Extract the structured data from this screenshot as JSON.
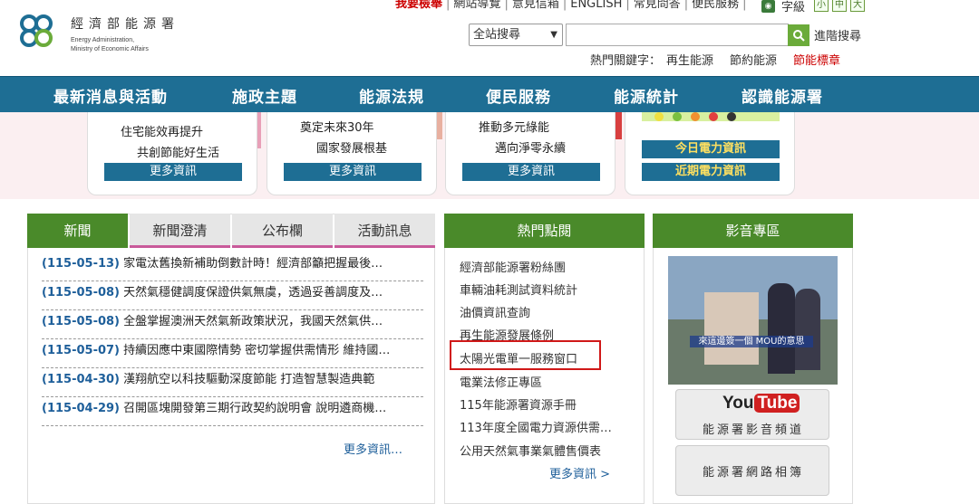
{
  "header": {
    "logo_title": "經濟部能源署",
    "logo_sub_1": "Energy Administration,",
    "logo_sub_2": "Ministry of Economic Affairs",
    "top_links": [
      "要檢舉",
      "網站導覽",
      "意見信箱",
      "ENGLISH",
      "常見問答",
      "便民服務"
    ],
    "top_link_first_prefix": "我",
    "font_label": "字級",
    "font_sizes": [
      "小",
      "中",
      "大"
    ],
    "search_scope": "全站搜尋",
    "search_value": "",
    "advanced_search": "進階搜尋",
    "hot_keywords_label": "熱門關鍵字：",
    "hot_keywords": [
      "再生能源",
      "節約能源",
      "節能標章"
    ]
  },
  "nav": [
    "最新消息與活動",
    "施政主題",
    "能源法規",
    "便民服務",
    "能源統計",
    "認識能源署"
  ],
  "cards": [
    {
      "line1": "住宅能效再提升",
      "line2": "共創節能好生活",
      "more": "更多資訊"
    },
    {
      "line1": "奠定未來30年",
      "line2": "國家發展根基",
      "more": "更多資訊"
    },
    {
      "line1": "推動多元綠能",
      "line2": "邁向淨零永續",
      "more": "更多資訊"
    },
    {
      "today": "今日電力資訊",
      "recent": "近期電力資訊"
    }
  ],
  "news_tabs": [
    "新聞",
    "新聞澄清",
    "公布欄",
    "活動訊息"
  ],
  "news": [
    {
      "date": "(115-05-13)",
      "title": "家電汰舊換新補助倒數計時！經濟部籲把握最後…"
    },
    {
      "date": "(115-05-08)",
      "title": "天然氣穩健調度保證供氣無虞，透過妥善調度及…"
    },
    {
      "date": "(115-05-08)",
      "title": "全盤掌握澳洲天然氣新政策狀況，我國天然氣供…"
    },
    {
      "date": "(115-05-07)",
      "title": "持續因應中東國際情勢 密切掌握供需情形 維持國…"
    },
    {
      "date": "(115-04-30)",
      "title": "漢翔航空以科技驅動深度節能 打造智慧製造典範"
    },
    {
      "date": "(115-04-29)",
      "title": "召開區塊開發第三期行政契約說明會 說明遴商機…"
    }
  ],
  "news_more": "更多資訊…",
  "hot_clicks": {
    "title": "熱門點閱",
    "items": [
      "經濟部能源署粉絲團",
      "車輛油耗測試資料統計",
      "油價資訊查詢",
      "再生能源發展條例",
      "太陽光電單一服務窗口",
      "電業法修正專區",
      "115年能源署資源手冊",
      "113年度全國電力資源供需…",
      "公用天然氣事業氣體售價表"
    ],
    "more": "更多資訊 >"
  },
  "media": {
    "title": "影音專區",
    "video_caption": "來這邊簽一個 MOU的意思",
    "youtube_logo_you": "You",
    "youtube_logo_tube": "Tube",
    "youtube_label": "能源署影音頻道",
    "album_label": "能源署網路相簿"
  },
  "colors": {
    "nav": "#1e6e94",
    "green": "#4a8a2a",
    "red": "#c00000",
    "highlight": "#d01818"
  }
}
